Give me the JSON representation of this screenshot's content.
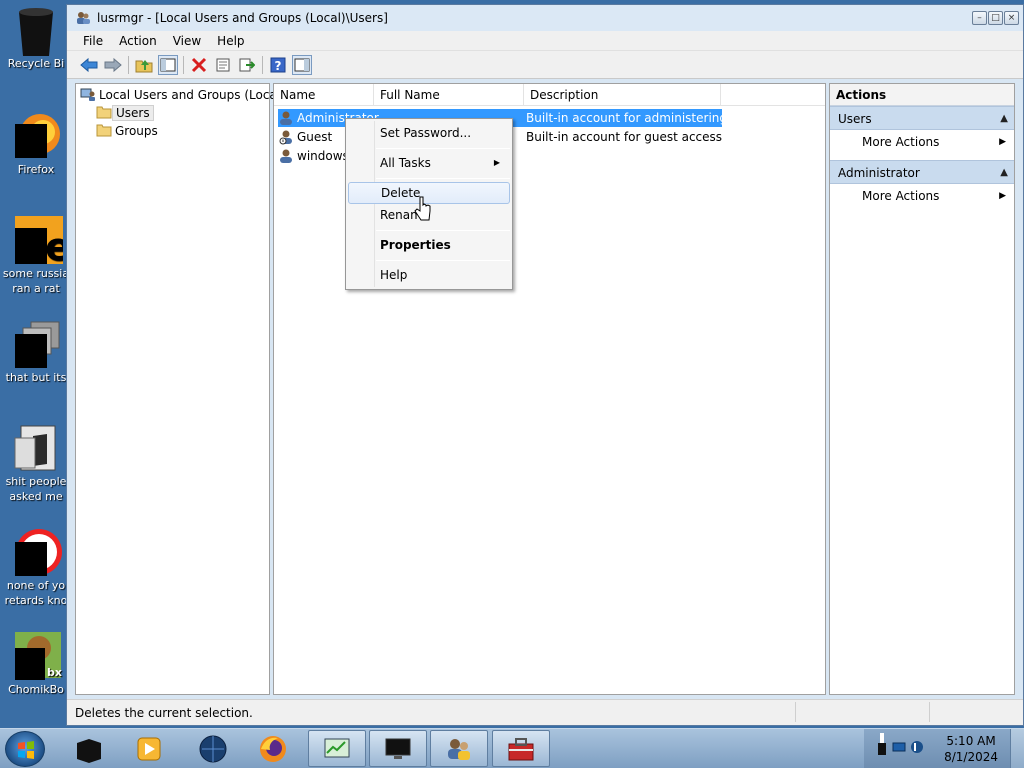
{
  "desktop": {
    "icons": [
      {
        "label1": "Recycle Bi",
        "label2": ""
      },
      {
        "label1": "Firefox",
        "label2": ""
      },
      {
        "label1": "some russia",
        "label2": "ran a rat"
      },
      {
        "label1": "that but its",
        "label2": ""
      },
      {
        "label1": "shit people",
        "label2": "asked me"
      },
      {
        "label1": "none of yo",
        "label2": "retards kno"
      },
      {
        "label1": "ChomikBo",
        "label2": ""
      }
    ]
  },
  "window": {
    "title": "lusrmgr - [Local Users and Groups (Local)\\Users]",
    "menu": [
      "File",
      "Action",
      "View",
      "Help"
    ]
  },
  "tree": {
    "root": "Local Users and Groups (Local)",
    "children": [
      "Users",
      "Groups"
    ]
  },
  "list": {
    "columns": [
      "Name",
      "Full Name",
      "Description"
    ],
    "rows": [
      {
        "name": "Administrator",
        "full": "",
        "desc": "Built-in account for administering..."
      },
      {
        "name": "Guest",
        "full": "",
        "desc": "Built-in account for guest access t..."
      },
      {
        "name": "windows",
        "full": "",
        "desc": ""
      }
    ]
  },
  "context_menu": {
    "items": [
      "Set Password...",
      "All Tasks",
      "Delete",
      "Rename",
      "Properties",
      "Help"
    ],
    "hovered": "Delete"
  },
  "actions": {
    "title": "Actions",
    "sections": [
      {
        "header": "Users",
        "item": "More Actions"
      },
      {
        "header": "Administrator",
        "item": "More Actions"
      }
    ]
  },
  "status": {
    "text": "Deletes the current selection."
  },
  "taskbar": {
    "time": "5:10 AM",
    "date": "8/1/2024"
  },
  "colors": {
    "selection": "#3399ff",
    "desktop": "#3a6ea5"
  }
}
